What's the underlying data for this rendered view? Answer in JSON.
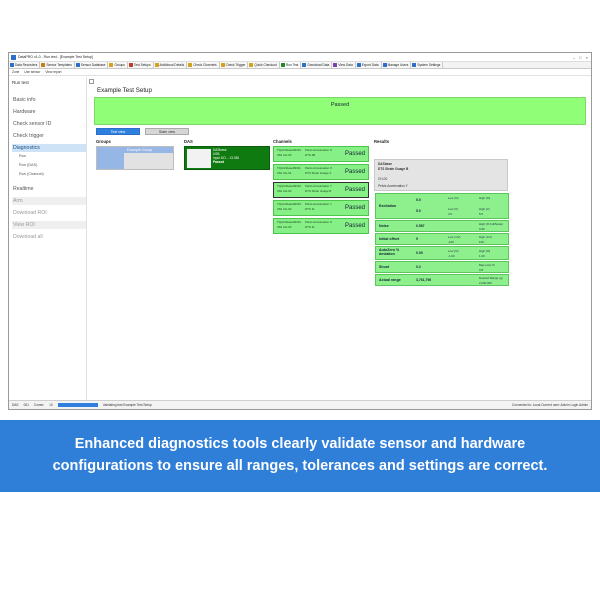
{
  "window": {
    "title": "DataPRO v1.0 - Run test - [Example Test Setup]",
    "controls": [
      "–",
      "□",
      "×"
    ]
  },
  "tabs": [
    {
      "label": "Data Recorders",
      "color": "#2a6fc9"
    },
    {
      "label": "Sensor Templates",
      "color": "#cc7a1e"
    },
    {
      "label": "Sensor Database",
      "color": "#2a6fc9"
    },
    {
      "label": "Groups",
      "color": "#d6a21e"
    },
    {
      "label": "Test Setups",
      "color": "#c0392b"
    },
    {
      "label": "Additional Details",
      "color": "#d6a21e"
    },
    {
      "label": "Check Channels",
      "color": "#d6a21e"
    },
    {
      "label": "Check Trigger",
      "color": "#d6a21e"
    },
    {
      "label": "Quick Checkout",
      "color": "#d6a21e"
    },
    {
      "label": "Run Test",
      "color": "#1e8a1e",
      "active": true
    },
    {
      "label": "Download Data",
      "color": "#2a6fc9"
    },
    {
      "label": "View Data",
      "color": "#7a3fb5"
    },
    {
      "label": "Export Data",
      "color": "#2a6fc9"
    },
    {
      "label": "Manage Users",
      "color": "#2a6fc9"
    },
    {
      "label": "System Settings",
      "color": "#2a6fc9"
    }
  ],
  "toolbar": {
    "items": [
      "Zone",
      "Use sensor",
      "View report"
    ]
  },
  "sidebar": {
    "title": "Run test",
    "items": [
      {
        "label": "Basic info"
      },
      {
        "label": "Hardware"
      },
      {
        "label": "Check sensor ID"
      },
      {
        "label": "Check trigger"
      }
    ],
    "active": "Diagnostics",
    "sub_items": [
      "Run",
      "Run (DAS)",
      "Run (Channel)"
    ],
    "items_after": [
      {
        "label": "Realtime"
      },
      {
        "label": "Arm"
      },
      {
        "label": "Download ROI"
      },
      {
        "label": "View ROI"
      },
      {
        "label": "Download all"
      }
    ]
  },
  "main": {
    "setup_title": "Example Test Setup",
    "overall_status": "Passed",
    "buttons": {
      "test": "Test view",
      "state": "State view"
    },
    "columns": {
      "groups": "Groups",
      "das": "DAS",
      "channels": "Channels",
      "results": "Results"
    },
    "group": {
      "name": "Example Group"
    },
    "das": {
      "name": "DASbase",
      "usb": "USB",
      "input": "Input DO... 13.336",
      "status": "Passed"
    },
    "channels": [
      {
        "id": "TQAC4base09310",
        "sub": "3S2 CH-00",
        "name": "Pelvis Acceleration Z",
        "sensor": "DTS 4B",
        "status": "Passed"
      },
      {
        "id": "TQAC4base09311",
        "sub": "3S2 CH-01",
        "name": "Pelvis Acceleration X",
        "sensor": "DTS Strain Guage X",
        "status": "Passed"
      },
      {
        "id": "TQAC4base09310",
        "sub": "3S2 CH-00",
        "name": "Pelvis Acceleration Y",
        "sensor": "DTS Strain Guage B",
        "status": "Passed",
        "selected": true
      },
      {
        "id": "TQAC4base09310",
        "sub": "3S2 CH-00",
        "name": "Pelvis Acceleration Y",
        "sensor": "DTS 11",
        "status": "Passed"
      },
      {
        "id": "TQAC4base09310",
        "sub": "3S2 CH-00",
        "name": "Pelvis Acceleration Z",
        "sensor": "DTS 11",
        "status": "Passed"
      }
    ],
    "results": {
      "das_name": "DASbase",
      "sensor": "DTS Strain Guage B",
      "channel": "CH-00",
      "description": "Pelvis Acceleration Y",
      "rows": [
        {
          "label": "Excitation",
          "value": "5.0",
          "value2": "5.0",
          "sub": [
            "Low (%)",
            "High (%)",
            "Low (V)",
            "High (V)",
            "4.5",
            "5.5"
          ]
        },
        {
          "label": "Noise",
          "value": "0.567",
          "sub": [
            "High (% FullScale)",
            "0.90"
          ]
        },
        {
          "label": "Initial offset",
          "value": "9",
          "sub": [
            "Low (mV)",
            "High (mV)",
            "-100",
            "100"
          ]
        },
        {
          "label": "AutoZero % deviation",
          "value": "0.05",
          "sub": [
            "Low (%)",
            "High (%)",
            "-1.00",
            "1.00"
          ]
        },
        {
          "label": "Shunt",
          "value": "0.2",
          "sub": [
            "Max error %",
            "0.8"
          ]
        },
        {
          "label": "Actual range",
          "value": "3,761,796",
          "sub": [
            "Desired Range (g)",
            "2,000,000"
          ]
        }
      ]
    }
  },
  "statusbar": {
    "left": [
      "DAS",
      "001",
      "Comm:",
      "10"
    ],
    "message": "Validating test Example Test Setup",
    "right": "Connected to:  Local    Current user: Admin    Login Admin"
  },
  "banner": {
    "line1": "Enhanced diagnostics tools clearly validate sensor and hardware",
    "line2": "configurations to ensure all ranges, tolerances and settings are correct."
  }
}
